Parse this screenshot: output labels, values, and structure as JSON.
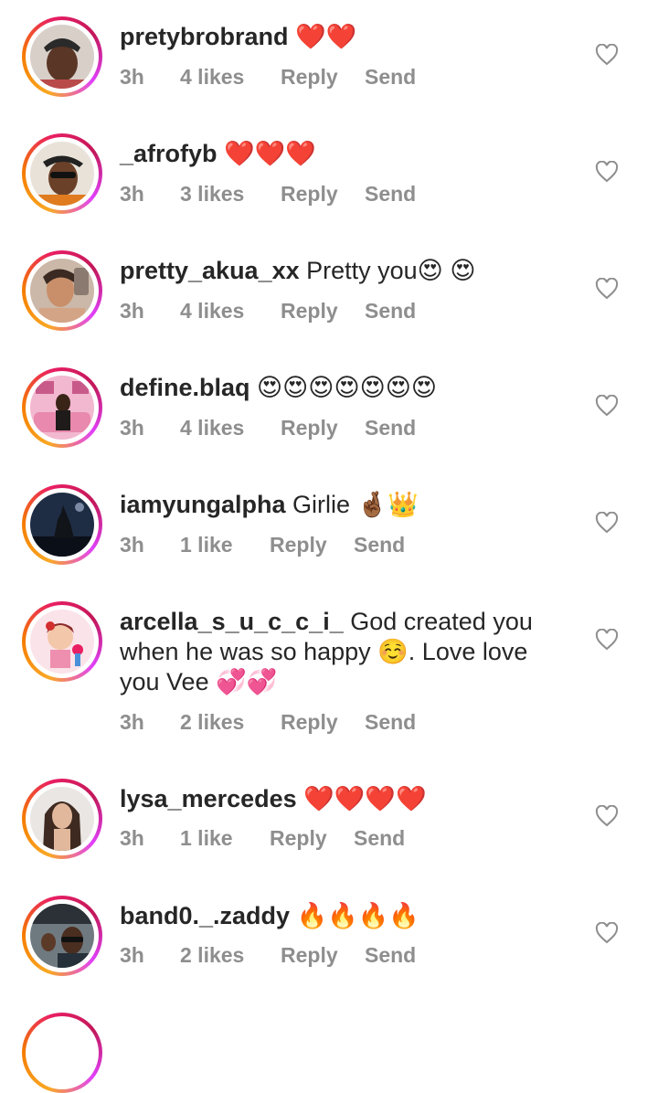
{
  "comments": [
    {
      "username": "pretybrobrand",
      "text": " ❤️❤️",
      "time": "3h",
      "likes": "4 likes",
      "reply": "Reply",
      "send": "Send",
      "avatar": "portrait-man-cap"
    },
    {
      "username": "_afrofyb",
      "text": " ❤️❤️❤️",
      "time": "3h",
      "likes": "3 likes",
      "reply": "Reply",
      "send": "Send",
      "avatar": "portrait-man-shades"
    },
    {
      "username": "pretty_akua_xx",
      "text": " Pretty you😍 😍",
      "time": "3h",
      "likes": "4 likes",
      "reply": "Reply",
      "send": "Send",
      "avatar": "portrait-woman-selfie"
    },
    {
      "username": "define.blaq",
      "text": " 😍😍😍😍😍😍😍",
      "time": "3h",
      "likes": "4 likes",
      "reply": "Reply",
      "send": "Send",
      "avatar": "portrait-pink-room"
    },
    {
      "username": "iamyungalpha",
      "text": " Girlie 🤞🏾👑",
      "time": "3h",
      "likes": "1 like",
      "reply": "Reply",
      "send": "Send",
      "avatar": "wolf-night"
    },
    {
      "username": "arcella_s_u_c_c_i_",
      "text": " God created you when he was so happy ☺️. Love love you Vee 💞💞",
      "time": "3h",
      "likes": "2 likes",
      "reply": "Reply",
      "send": "Send",
      "avatar": "cartoon-girl-flowers"
    },
    {
      "username": "lysa_mercedes",
      "text": " ❤️❤️❤️❤️",
      "time": "3h",
      "likes": "1 like",
      "reply": "Reply",
      "send": "Send",
      "avatar": "portrait-woman-hair"
    },
    {
      "username": "band0._.zaddy",
      "text": " 🔥🔥🔥🔥",
      "time": "3h",
      "likes": "2 likes",
      "reply": "Reply",
      "send": "Send",
      "avatar": "portrait-man-car"
    }
  ],
  "like_icon": "heart-outline-icon"
}
